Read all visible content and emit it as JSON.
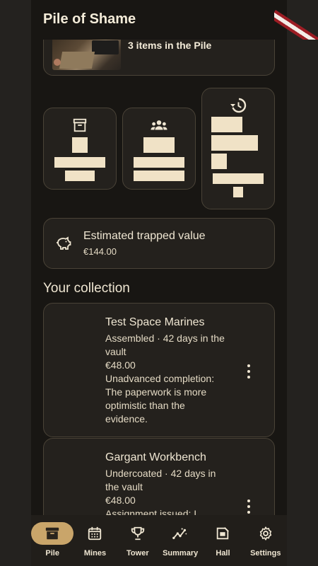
{
  "header": {
    "title": "Pile of Shame"
  },
  "hero": {
    "text": "3 items in the Pile"
  },
  "stats": {
    "archive_icon": "archive-box-icon",
    "group_icon": "group-icon",
    "history_icon": "history-icon"
  },
  "trapped": {
    "label": "Estimated trapped value",
    "value": "€144.00",
    "icon": "piggy-bank-icon"
  },
  "collection": {
    "title": "Your collection",
    "items": [
      {
        "name": "Test Space Marines",
        "meta": "Assembled · 42 days in the vault",
        "price": "€48.00",
        "note": "Unadvanced completion: The paperwork is more optimistic than the evidence."
      },
      {
        "name": "Gargant Workbench",
        "meta": "Undercoated · 42 days in the vault",
        "price": "€48.00",
        "note": "Assignment issued: I"
      }
    ]
  },
  "nav": [
    {
      "label": "Pile",
      "icon": "pile-box-icon",
      "active": true
    },
    {
      "label": "Mines",
      "icon": "calendar-icon"
    },
    {
      "label": "Tower",
      "icon": "trophy-icon"
    },
    {
      "label": "Summary",
      "icon": "insights-icon"
    },
    {
      "label": "Hall",
      "icon": "hall-icon"
    },
    {
      "label": "Settings",
      "icon": "gear-icon"
    }
  ],
  "colors": {
    "background": "#181613",
    "card": "#24211d",
    "accent": "#c9a56a",
    "text": "#efe6d2",
    "ribbon_red": "#9c1d24"
  }
}
